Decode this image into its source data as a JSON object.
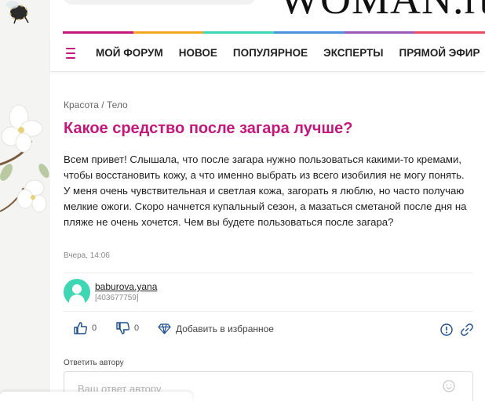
{
  "site": {
    "logo_text": "WOMAN.ru"
  },
  "colors": {
    "accent": "#c2187a",
    "avatar_bg": "#3ed6b3",
    "rainbow": [
      "#c2187a",
      "#f6a623",
      "#3ed6b3",
      "#4a90e2",
      "#9b59b6",
      "#e84a5f"
    ]
  },
  "nav": {
    "items": [
      {
        "label": "МОЙ ФОРУМ"
      },
      {
        "label": "НОВОЕ"
      },
      {
        "label": "ПОПУЛЯРНОЕ"
      },
      {
        "label": "ЭКСПЕРТЫ"
      },
      {
        "label": "ПРЯМОЙ ЭФИР"
      }
    ]
  },
  "breadcrumb": {
    "category": "Красота",
    "separator": " / ",
    "subcategory": "Тело"
  },
  "post": {
    "title": "Какое средство после загара лучше?",
    "body": "Всем привет! Слышала, что после загара нужно пользоваться какими-то кремами, чтобы восстановить кожу, а что именно выбрать из всего изобилия не могу понять. У меня очень чувствительная и светлая кожа, загорать я люблю, но часто получаю мелкие ожоги. Скоро начнется купальный сезон, а мазаться сметаной после дня на пляже не очень хочется. Чем вы будете пользоваться после загара?",
    "date": "Вчера, 14:06"
  },
  "author": {
    "name": "baburova.yana",
    "id": "[403677759]"
  },
  "actions": {
    "likes": "0",
    "dislikes": "0",
    "favorite_label": "Добавить в избранное"
  },
  "reply": {
    "label": "Ответить автору",
    "placeholder": "Ваш ответ автору"
  }
}
